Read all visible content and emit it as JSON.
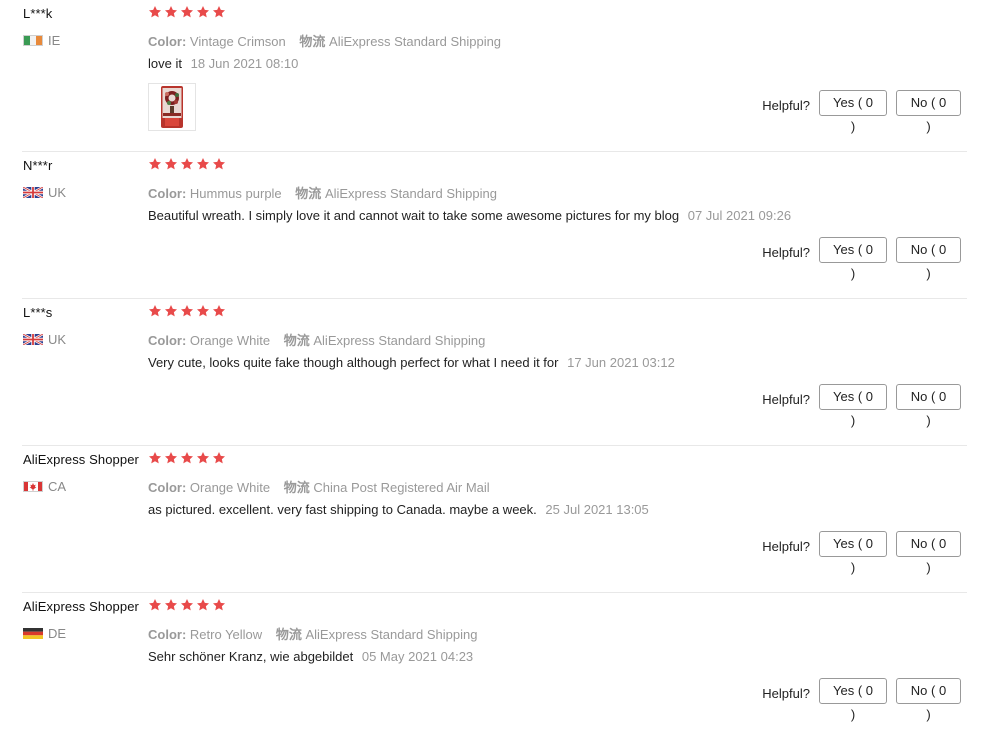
{
  "helpful_label": "Helpful?",
  "star_color": "#e84a4a",
  "reviews": [
    {
      "user": "L***k",
      "country": "IE",
      "flag": "ireland",
      "stars": 5,
      "color_label": "Color:",
      "color_value": "Vintage Crimson",
      "shipping_label": "物流",
      "shipping_value": "AliExpress Standard Shipping",
      "text": "love it",
      "date": "18 Jun 2021 08:10",
      "has_photo": true,
      "yes_label": "Yes ( 0 )",
      "no_label": "No ( 0 )"
    },
    {
      "user": "N***r",
      "country": "UK",
      "flag": "uk",
      "stars": 5,
      "color_label": "Color:",
      "color_value": "Hummus purple",
      "shipping_label": "物流",
      "shipping_value": "AliExpress Standard Shipping",
      "text": "Beautiful wreath. I simply love it and cannot wait to take some awesome pictures for my blog",
      "date": "07 Jul 2021 09:26",
      "has_photo": false,
      "yes_label": "Yes ( 0 )",
      "no_label": "No ( 0 )"
    },
    {
      "user": "L***s",
      "country": "UK",
      "flag": "uk",
      "stars": 5,
      "color_label": "Color:",
      "color_value": "Orange White",
      "shipping_label": "物流",
      "shipping_value": "AliExpress Standard Shipping",
      "text": "Very cute, looks quite fake though although perfect for what I need it for",
      "date": "17 Jun 2021 03:12",
      "has_photo": false,
      "yes_label": "Yes ( 0 )",
      "no_label": "No ( 0 )"
    },
    {
      "user": "AliExpress Shopper",
      "country": "CA",
      "flag": "canada",
      "stars": 5,
      "color_label": "Color:",
      "color_value": "Orange White",
      "shipping_label": "物流",
      "shipping_value": "China Post Registered Air Mail",
      "text": "as pictured. excellent. very fast shipping to Canada. maybe a week.",
      "date": "25 Jul 2021 13:05",
      "has_photo": false,
      "yes_label": "Yes ( 0 )",
      "no_label": "No ( 0 )"
    },
    {
      "user": "AliExpress Shopper",
      "country": "DE",
      "flag": "germany",
      "stars": 5,
      "color_label": "Color:",
      "color_value": "Retro Yellow",
      "shipping_label": "物流",
      "shipping_value": "AliExpress Standard Shipping",
      "text": "Sehr schöner Kranz, wie abgebildet",
      "date": "05 May 2021 04:23",
      "has_photo": false,
      "yes_label": "Yes ( 0 )",
      "no_label": "No ( 0 )"
    }
  ]
}
